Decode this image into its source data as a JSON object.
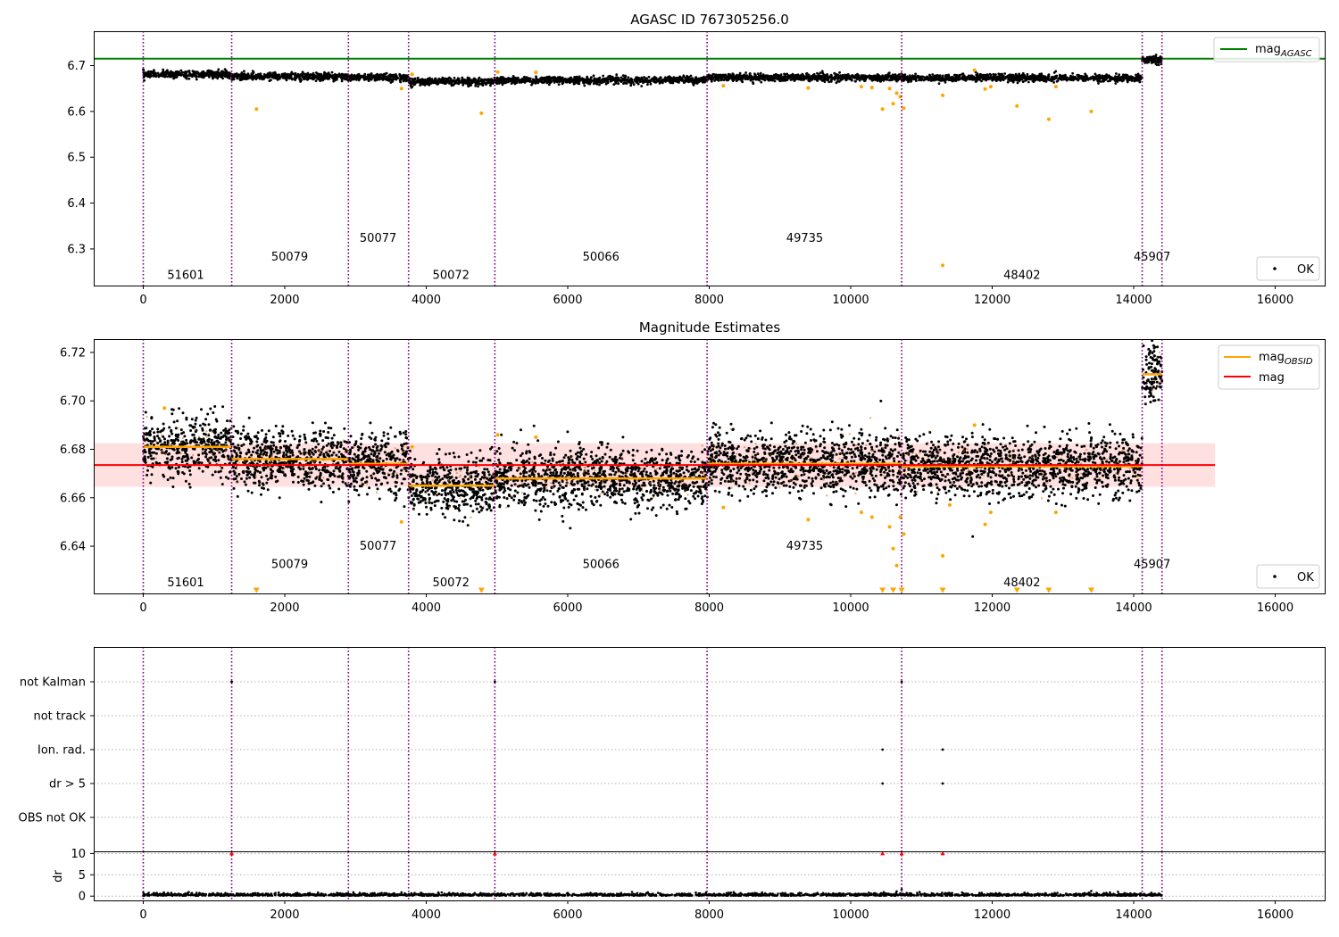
{
  "figure": {
    "title_top": "AGASC ID 767305256.0",
    "title_mid": "Magnitude Estimates"
  },
  "colors": {
    "ok": "#000000",
    "outlier": "#ffa500",
    "mag_agasc": "#008000",
    "mag_obsid": "#ffa500",
    "mag": "#ff0000",
    "band": "#ffcccc",
    "obs_line": "#800080",
    "flag_red": "#ff0000"
  },
  "chart_data": [
    {
      "id": "top",
      "type": "scatter",
      "title": "AGASC ID 767305256.0",
      "xlim": [
        -700,
        16700
      ],
      "ylim": [
        6.22,
        6.775
      ],
      "xticks": [
        "0",
        "2000",
        "4000",
        "6000",
        "8000",
        "10000",
        "12000",
        "14000",
        "16000"
      ],
      "yticks": [
        "6.3",
        "6.4",
        "6.5",
        "6.6",
        "6.7"
      ],
      "ytick_values": [
        6.3,
        6.4,
        6.5,
        6.6,
        6.7
      ],
      "legend_upper": [
        {
          "name": "mag",
          "subscript": "AGASC",
          "color": "#008000"
        }
      ],
      "legend_lower": [
        {
          "name": "OK",
          "marker": "dot"
        }
      ],
      "hline": {
        "name": "mag_AGASC",
        "value": 6.715,
        "x": [
          -700,
          16700
        ]
      },
      "observation_boundaries": [
        0,
        1250,
        2900,
        3750,
        4970,
        7970,
        10720,
        14120,
        14400
      ],
      "obsids": [
        {
          "label": "51601",
          "x": 600,
          "y": 6.235
        },
        {
          "label": "50079",
          "x": 2070,
          "y": 6.275
        },
        {
          "label": "50077",
          "x": 3320,
          "y": 6.315
        },
        {
          "label": "50072",
          "x": 4350,
          "y": 6.235
        },
        {
          "label": "50066",
          "x": 6470,
          "y": 6.275
        },
        {
          "label": "49735",
          "x": 9350,
          "y": 6.315
        },
        {
          "label": "48402",
          "x": 12420,
          "y": 6.235
        },
        {
          "label": "45907",
          "x": 14260,
          "y": 6.275
        }
      ],
      "ok_bands": [
        {
          "x": [
            0,
            1250
          ],
          "center": 6.681,
          "spread": 0.007
        },
        {
          "x": [
            1250,
            2900
          ],
          "center": 6.676,
          "spread": 0.007
        },
        {
          "x": [
            2900,
            3750
          ],
          "center": 6.674,
          "spread": 0.007
        },
        {
          "x": [
            3750,
            4970
          ],
          "center": 6.665,
          "spread": 0.007
        },
        {
          "x": [
            4970,
            7970
          ],
          "center": 6.668,
          "spread": 0.007
        },
        {
          "x": [
            7970,
            10720
          ],
          "center": 6.674,
          "spread": 0.007
        },
        {
          "x": [
            10720,
            14120
          ],
          "center": 6.673,
          "spread": 0.007
        },
        {
          "x": [
            14120,
            14400
          ],
          "center": 6.712,
          "spread": 0.008
        }
      ],
      "outliers": {
        "x": [
          1600,
          3650,
          3800,
          4780,
          5010,
          5550,
          8200,
          9400,
          10150,
          10300,
          10450,
          10550,
          10600,
          10650,
          10700,
          10750,
          11300,
          11300,
          11750,
          11900,
          11980,
          12350,
          12800,
          12900,
          13400
        ],
        "y": [
          6.605,
          6.65,
          6.681,
          6.596,
          6.686,
          6.685,
          6.656,
          6.651,
          6.654,
          6.652,
          6.605,
          6.65,
          6.617,
          6.64,
          6.632,
          6.607,
          6.635,
          6.264,
          6.69,
          6.649,
          6.654,
          6.612,
          6.583,
          6.654,
          6.6
        ]
      }
    },
    {
      "id": "middle",
      "type": "scatter",
      "title": "Magnitude Estimates",
      "xlim": [
        -700,
        16700
      ],
      "ylim": [
        6.6205,
        6.7255
      ],
      "xticks": [
        "0",
        "2000",
        "4000",
        "6000",
        "8000",
        "10000",
        "12000",
        "14000",
        "16000"
      ],
      "yticks": [
        "6.64",
        "6.66",
        "6.68",
        "6.70",
        "6.72"
      ],
      "ytick_values": [
        6.64,
        6.66,
        6.68,
        6.7,
        6.72
      ],
      "legend_upper": [
        {
          "name": "mag",
          "subscript": "OBSID",
          "color": "#ffa500"
        },
        {
          "name": "mag",
          "subscript": "",
          "color": "#ff0000"
        }
      ],
      "legend_lower": [
        {
          "name": "OK",
          "marker": "dot"
        }
      ],
      "mag": {
        "value": 6.6735,
        "band": [
          6.6645,
          6.6825
        ],
        "x": [
          -700,
          15150
        ]
      },
      "mag_obsid": [
        {
          "x": [
            0,
            1250
          ],
          "value": 6.681
        },
        {
          "x": [
            1250,
            2900
          ],
          "value": 6.676
        },
        {
          "x": [
            2900,
            3750
          ],
          "value": 6.674
        },
        {
          "x": [
            3750,
            4970
          ],
          "value": 6.665
        },
        {
          "x": [
            4970,
            7970
          ],
          "value": 6.668
        },
        {
          "x": [
            7970,
            10720
          ],
          "value": 6.674
        },
        {
          "x": [
            10720,
            14120
          ],
          "value": 6.673
        },
        {
          "x": [
            14120,
            14400
          ],
          "value": 6.711
        }
      ],
      "observation_boundaries": [
        0,
        1250,
        2900,
        3750,
        4970,
        7970,
        10720,
        14120,
        14400
      ],
      "obsids": [
        {
          "label": "51601",
          "x": 600,
          "y": 6.6235
        },
        {
          "label": "50079",
          "x": 2070,
          "y": 6.631
        },
        {
          "label": "50077",
          "x": 3320,
          "y": 6.6385
        },
        {
          "label": "50072",
          "x": 4350,
          "y": 6.6235
        },
        {
          "label": "50066",
          "x": 6470,
          "y": 6.631
        },
        {
          "label": "49735",
          "x": 9350,
          "y": 6.6385
        },
        {
          "label": "48402",
          "x": 12420,
          "y": 6.6235
        },
        {
          "label": "45907",
          "x": 14260,
          "y": 6.631
        }
      ],
      "outliers": {
        "x": [
          300,
          3650,
          3800,
          5010,
          5550,
          8200,
          9400,
          10150,
          10300,
          10550,
          10600,
          10650,
          10700,
          10750,
          11300,
          11400,
          11750,
          11900,
          11980,
          12900
        ],
        "y": [
          6.697,
          6.65,
          6.681,
          6.686,
          6.685,
          6.656,
          6.651,
          6.654,
          6.652,
          6.648,
          6.639,
          6.632,
          6.652,
          6.645,
          6.636,
          6.657,
          6.69,
          6.649,
          6.654,
          6.654
        ]
      },
      "below_range_x": [
        1600,
        4780,
        10450,
        10600,
        10720,
        11300,
        12350,
        12800,
        13400
      ]
    },
    {
      "id": "flags",
      "type": "scatter",
      "ylabel": "",
      "xlim": [
        -700,
        16700
      ],
      "categories": [
        "not Kalman",
        "not track",
        "Ion. rad.",
        "dr > 5",
        "OBS not OK"
      ],
      "observation_boundaries": [
        0,
        1250,
        2900,
        3750,
        4970,
        7970,
        10720,
        14120,
        14400
      ],
      "flagged": [
        {
          "category": "not Kalman",
          "x": [
            1250,
            4970,
            10720
          ]
        },
        {
          "category": "Ion. rad.",
          "x": [
            10450,
            11300
          ]
        },
        {
          "category": "dr > 5",
          "x": [
            10450,
            11300
          ]
        }
      ]
    },
    {
      "id": "dr",
      "type": "scatter",
      "ylabel": "dr",
      "xlim": [
        -700,
        16700
      ],
      "ylim": [
        -1,
        10.5
      ],
      "xticks": [
        "0",
        "2000",
        "4000",
        "6000",
        "8000",
        "10000",
        "12000",
        "14000",
        "16000"
      ],
      "yticks": [
        "0",
        "5",
        "10"
      ],
      "ytick_values": [
        0,
        5,
        10
      ],
      "observation_boundaries": [
        0,
        1250,
        2900,
        3750,
        4970,
        7970,
        10720,
        14120,
        14400
      ],
      "clipped_red_x": [
        1250,
        4970,
        10450,
        10720,
        11300
      ],
      "typical_dr": [
        0.1,
        0.6
      ],
      "spikes": {
        "x": [
          3650,
          10650,
          10720,
          13400
        ],
        "y": [
          0.9,
          1.1,
          1.6,
          1.2
        ]
      }
    }
  ]
}
